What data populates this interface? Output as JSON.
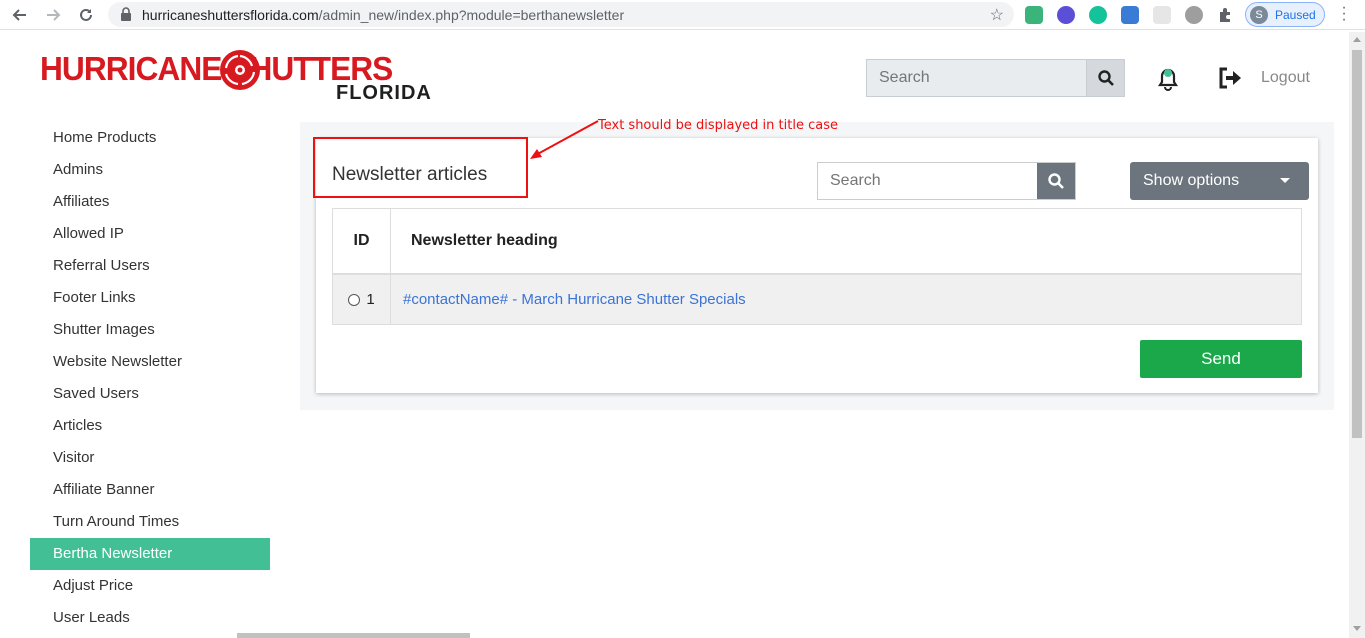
{
  "browser": {
    "url_host": "hurricaneshuttersflorida.com",
    "url_path": "/admin_new/index.php?module=berthanewsletter",
    "profile_initial": "S",
    "profile_status": "Paused"
  },
  "logo": {
    "main": "HURRICANE  SHUTTERS",
    "sub": "FLORIDA"
  },
  "header": {
    "search_placeholder": "Search",
    "logout_label": "Logout"
  },
  "sidebar": {
    "items": [
      {
        "label": "Home Products"
      },
      {
        "label": "Admins"
      },
      {
        "label": "Affiliates"
      },
      {
        "label": "Allowed IP"
      },
      {
        "label": "Referral Users"
      },
      {
        "label": "Footer Links"
      },
      {
        "label": "Shutter Images"
      },
      {
        "label": "Website Newsletter"
      },
      {
        "label": "Saved Users"
      },
      {
        "label": "Articles"
      },
      {
        "label": "Visitor"
      },
      {
        "label": "Affiliate Banner"
      },
      {
        "label": "Turn Around Times"
      },
      {
        "label": "Bertha Newsletter"
      },
      {
        "label": "Adjust Price"
      },
      {
        "label": "User Leads"
      }
    ],
    "active_item": "Bertha Newsletter"
  },
  "main": {
    "title": "Newsletter articles",
    "annotation": "Text should be displayed in title case",
    "search_placeholder": "Search",
    "options_label": "Show options",
    "table": {
      "headers": [
        "ID",
        "Newsletter heading"
      ],
      "rows": [
        {
          "id": "1",
          "heading": "#contactName# - March Hurricane Shutter Specials"
        }
      ]
    },
    "send_label": "Send"
  },
  "colors": {
    "brand_red": "#d71920",
    "active_green": "#43bf96",
    "send_green": "#1aa84a",
    "link_blue": "#3b73d6",
    "annotation_red": "#ee1111"
  }
}
